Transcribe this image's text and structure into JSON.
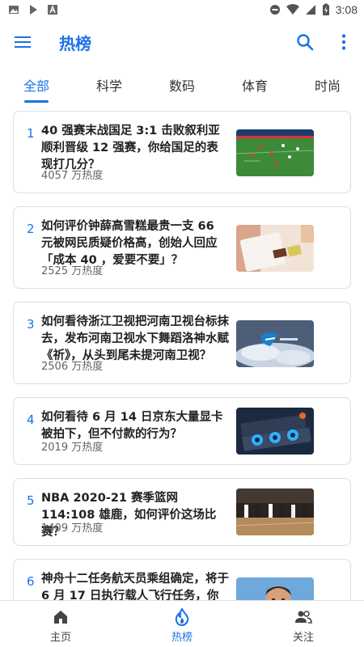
{
  "status_bar": {
    "time": "3:08",
    "left_icons": [
      "image-icon",
      "play-store-icon",
      "font-icon"
    ],
    "right_icons": [
      "do-not-disturb-icon",
      "wifi-icon",
      "signal-icon",
      "battery-charging-icon"
    ]
  },
  "app_bar": {
    "title": "热榜",
    "accent_color": "#1a73e8"
  },
  "tabs": [
    {
      "label": "全部",
      "active": true
    },
    {
      "label": "科学",
      "active": false
    },
    {
      "label": "数码",
      "active": false
    },
    {
      "label": "体育",
      "active": false
    },
    {
      "label": "时尚",
      "active": false
    }
  ],
  "items": [
    {
      "rank": "1",
      "title": "40 强赛末战国足 3:1 击败叙利亚顺利晋级 12 强赛，你给国足的表现打几分？",
      "heat": "4057 万热度",
      "thumb": "football-match-image"
    },
    {
      "rank": "2",
      "title": "如何评价钟薛高雪糕最贵一支 66 元被网民质疑价格高，创始人回应「成本 40 ，爱要不要」？",
      "heat": "2525 万热度",
      "thumb": "ice-cream-image"
    },
    {
      "rank": "3",
      "title": "如何看待浙江卫视把河南卫视台标抹去，发布河南卫视水下舞蹈洛神水赋《祈》，从头到尾未提河南卫视？",
      "heat": "2506 万热度",
      "thumb": "tv-logo-image"
    },
    {
      "rank": "4",
      "title": "如何看待 6 月 14 日京东大量显卡被拍下，但不付款的行为？",
      "heat": "2019 万热度",
      "thumb": "graphics-cards-image"
    },
    {
      "rank": "5",
      "title": "NBA 2020-21 赛季篮网 114:108 雄鹿，如何评价这场比赛？",
      "heat": "1409 万热度",
      "thumb": "basketball-game-image"
    },
    {
      "rank": "6",
      "title": "神舟十二任务航天员乘组确定，将于 6 月 17 日执行载人飞行任务，你有",
      "heat": "",
      "thumb": "astronaut-portrait-image"
    }
  ],
  "bottom_nav": [
    {
      "label": "主页",
      "icon": "home-icon",
      "active": false
    },
    {
      "label": "热榜",
      "icon": "fire-icon",
      "active": true
    },
    {
      "label": "关注",
      "icon": "people-icon",
      "active": false
    }
  ]
}
